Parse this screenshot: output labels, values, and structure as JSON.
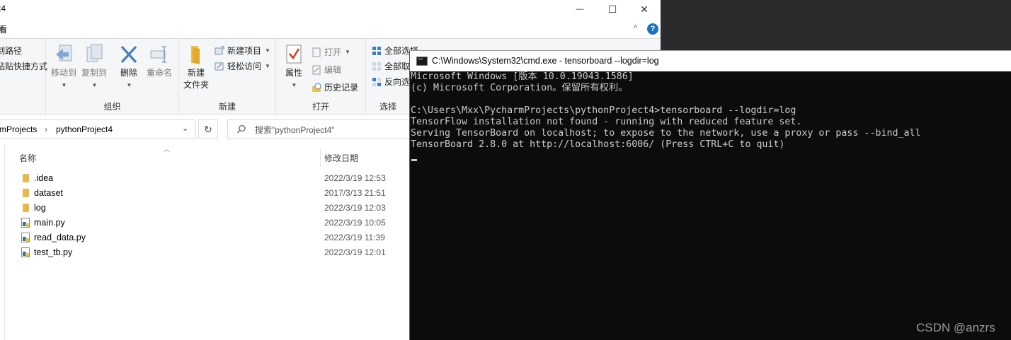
{
  "explorer": {
    "title_fragment": "t4",
    "window_controls": {
      "minimize": "—",
      "maximize": "☐",
      "close": "✕"
    },
    "menu": {
      "view_fragment": "看",
      "collapse": "^",
      "help": "?"
    },
    "ribbon": {
      "clipboard_partial": {
        "copy_path": "制路径",
        "paste_shortcut": "粘贴快捷方式"
      },
      "organize": {
        "label": "组织",
        "move_to": "移动到",
        "copy_to": "复制到",
        "delete": "删除",
        "rename": "重命名"
      },
      "new": {
        "label": "新建",
        "new_folder_line1": "新建",
        "new_folder_line2": "文件夹",
        "new_item": "新建项目",
        "easy_access": "轻松访问"
      },
      "open": {
        "label": "打开",
        "properties": "属性",
        "open": "打开",
        "edit": "编辑",
        "history": "历史记录"
      },
      "select": {
        "label": "选择",
        "select_all": "全部选择",
        "select_none": "全部取消",
        "invert": "反向选择"
      }
    },
    "address": {
      "crumbs": [
        "mProjects",
        "pythonProject4"
      ],
      "search_placeholder": "搜索\"pythonProject4\""
    },
    "columns": {
      "name": "名称",
      "date": "修改日期"
    },
    "files": [
      {
        "name": ".idea",
        "date": "2022/3/19 12:53",
        "type": "folder"
      },
      {
        "name": "dataset",
        "date": "2017/3/13 21:51",
        "type": "folder"
      },
      {
        "name": "log",
        "date": "2022/3/19 12:03",
        "type": "folder"
      },
      {
        "name": "main.py",
        "date": "2022/3/19 10:05",
        "type": "py"
      },
      {
        "name": "read_data.py",
        "date": "2022/3/19 11:39",
        "type": "py"
      },
      {
        "name": "test_tb.py",
        "date": "2022/3/19 12:01",
        "type": "py"
      }
    ]
  },
  "cmd": {
    "title": "C:\\Windows\\System32\\cmd.exe - tensorboard  --logdir=log",
    "lines": [
      "Microsoft Windows [版本 10.0.19043.1586]",
      "(c) Microsoft Corporation。保留所有权利。",
      "",
      "C:\\Users\\Mxx\\PycharmProjects\\pythonProject4>tensorboard --logdir=log",
      "TensorFlow installation not found - running with reduced feature set.",
      "Serving TensorBoard on localhost; to expose to the network, use a proxy or pass --bind_all",
      "TensorBoard 2.8.0 at http://localhost:6006/ (Press CTRL+C to quit)"
    ]
  },
  "watermark": "CSDN @anzrs"
}
